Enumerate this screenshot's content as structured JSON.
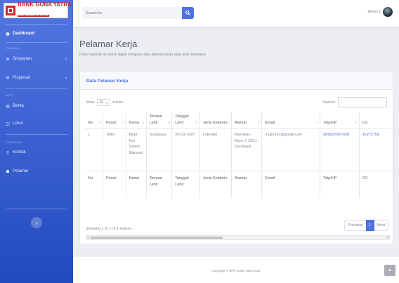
{
  "brand": {
    "name": "BANK GUNA YATRA",
    "sub": "BANK PERKREDITAN RAKYAT"
  },
  "sidebar": {
    "dashboard": "Dashboard",
    "headings": {
      "produk": "PRODUK",
      "info": "INFO",
      "tampilan": "TAMPILAN"
    },
    "items": [
      {
        "label": "Simpanan"
      },
      {
        "label": "Pinjaman"
      },
      {
        "label": "Berita"
      },
      {
        "label": "Loker"
      },
      {
        "label": "Kontak"
      },
      {
        "label": "Pelamar"
      }
    ],
    "toggle": "‹"
  },
  "topbar": {
    "search_placeholder": "Search for...",
    "user": "Admin 1"
  },
  "page": {
    "title": "Pelamar Kerja",
    "desc": "Pada halaman ini admin dapat mengatur data pelamar kerja yang telah terompan."
  },
  "card": {
    "title": "Data Pelamar Kerja"
  },
  "table_controls": {
    "show": "Show",
    "length": "10",
    "entries": "entries",
    "search": "Search:"
  },
  "table": {
    "headers": [
      "No",
      "Posisi",
      "Nama",
      "Tempat Lahir",
      "Tanggal Lahir",
      "Jenis Kelamin",
      "Alamat",
      "Email",
      "Telp/HP",
      "CV"
    ],
    "footers": [
      "No",
      "Posisi",
      "Nama",
      "Tempat Lahir",
      "Tanggal Lahir",
      "Jenis Kelamin",
      "Alamat",
      "Email",
      "Telp/HP",
      "CV"
    ],
    "rows": [
      [
        "1",
        "Teller",
        "Mujit Nur Salam Marsani",
        "Surabaya",
        "26-03-1997",
        "Laki-laki",
        "Manukan Kayu 3 12/11 Surabaya",
        "mujitnurs@gmail.com",
        "089637667028",
        "16272706"
      ]
    ]
  },
  "info": "Showing 1 to 1 of 1 entries",
  "pagination": {
    "prev": "Previous",
    "current": "1",
    "next": "Next"
  },
  "footer": "Copyright © BPR Guna Yatra 2021",
  "colors": {
    "primary": "#4e73df",
    "brand_red": "#c62828"
  }
}
